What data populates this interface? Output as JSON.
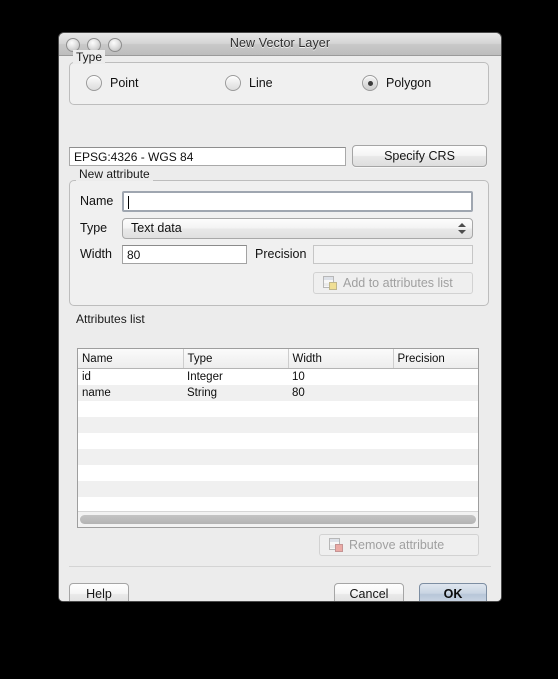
{
  "window": {
    "title": "New Vector Layer",
    "traffic_lights": [
      "close-button",
      "minimize-button",
      "zoom-button"
    ]
  },
  "type_group": {
    "label": "Type",
    "options": [
      {
        "label": "Point",
        "selected": false
      },
      {
        "label": "Line",
        "selected": false
      },
      {
        "label": "Polygon",
        "selected": true
      }
    ]
  },
  "crs": {
    "value": "EPSG:4326 - WGS 84",
    "button_label": "Specify CRS"
  },
  "new_attribute": {
    "label": "New attribute",
    "name_label": "Name",
    "name_value": "",
    "name_focused": true,
    "type_label": "Type",
    "type_value": "Text data",
    "width_label": "Width",
    "width_value": "80",
    "precision_label": "Precision",
    "precision_value": "",
    "add_button_label": "Add to attributes list",
    "add_button_icon": "add-attribute-icon",
    "add_button_enabled": false
  },
  "attributes_list": {
    "label": "Attributes list",
    "columns": [
      "Name",
      "Type",
      "Width",
      "Precision"
    ],
    "rows": [
      {
        "name": "id",
        "type": "Integer",
        "width": "10",
        "precision": ""
      },
      {
        "name": "name",
        "type": "String",
        "width": "80",
        "precision": ""
      },
      {
        "name": "",
        "type": "",
        "width": "",
        "precision": ""
      },
      {
        "name": "",
        "type": "",
        "width": "",
        "precision": ""
      },
      {
        "name": "",
        "type": "",
        "width": "",
        "precision": ""
      },
      {
        "name": "",
        "type": "",
        "width": "",
        "precision": ""
      },
      {
        "name": "",
        "type": "",
        "width": "",
        "precision": ""
      },
      {
        "name": "",
        "type": "",
        "width": "",
        "precision": ""
      },
      {
        "name": "",
        "type": "",
        "width": "",
        "precision": ""
      },
      {
        "name": "",
        "type": "",
        "width": "",
        "precision": ""
      },
      {
        "name": "",
        "type": "",
        "width": "",
        "precision": ""
      }
    ],
    "remove_button_label": "Remove attribute",
    "remove_button_icon": "remove-attribute-icon",
    "remove_button_enabled": false
  },
  "footer": {
    "help_label": "Help",
    "cancel_label": "Cancel",
    "ok_label": "OK",
    "default_button": "OK"
  },
  "colors": {
    "window_background": "#ececec",
    "group_background": "#f0f0f0",
    "field_background": "#ffffff",
    "row_alt_background": "#f0f0f0",
    "default_button_accent": "#c9d5e3",
    "focus_ring": "#9fa6b0",
    "page_background": "#000000"
  }
}
